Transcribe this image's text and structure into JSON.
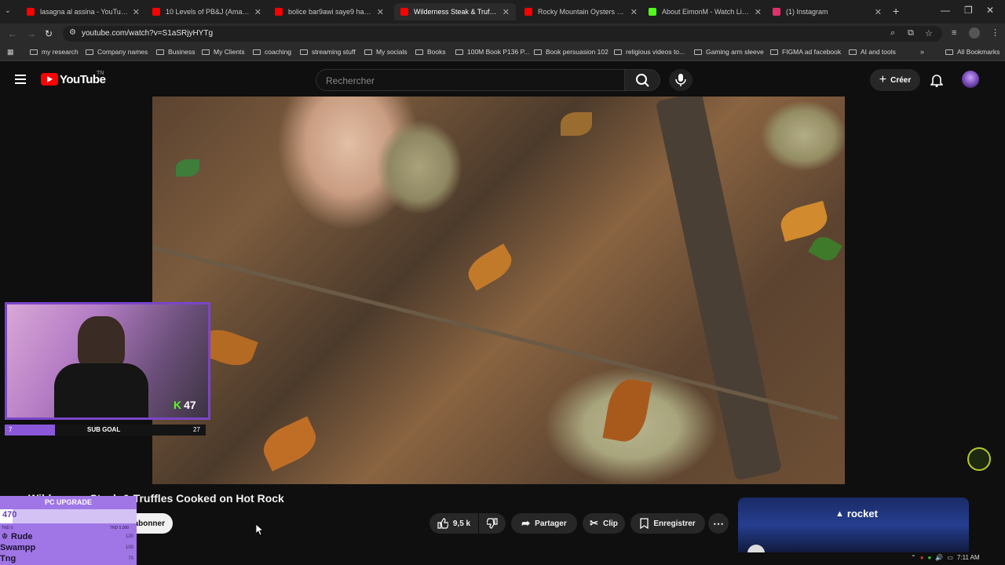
{
  "browser": {
    "tabs": [
      {
        "title": "lasagna al assina - YouTube",
        "color": "#ff0000"
      },
      {
        "title": "10 Levels of PB&J (Amateur to ...",
        "color": "#ff0000"
      },
      {
        "title": "bolice bar9awi saye9 hal9a - Yo...",
        "color": "#ff0000"
      },
      {
        "title": "Wilderness Steak & Truffle...",
        "color": "#ff0000"
      },
      {
        "title": "Rocky Mountain Oysters - YouT...",
        "color": "#ff0000"
      },
      {
        "title": "About EimonM - Watch Live on...",
        "color": "#53fc18"
      },
      {
        "title": "(1) Instagram",
        "color": "#e1306c"
      }
    ],
    "active_tab_index": 3,
    "url": "youtube.com/watch?v=S1aSRjyHYTg",
    "bookmarks": [
      "my research",
      "Company names",
      "Business",
      "My Clients",
      "coaching",
      "streaming stuff",
      "My socials",
      "Books",
      "100M Book P136 P...",
      "Book persuasion 102",
      "religious videos to...",
      "Gaming arm sleeve",
      "FIGMA ad facebook",
      "AI and tools"
    ],
    "all_bookmarks": "All Bookmarks"
  },
  "youtube": {
    "logo_text": "YouTube",
    "logo_sup": "TN",
    "search_placeholder": "Rechercher",
    "create_label": "Créer",
    "video_title": "Wilderness Steak & Truffles Cooked on Hot Rock",
    "subscribe_label": "abonner",
    "likes": "9,5 k",
    "share_label": "Partager",
    "clip_label": "Clip",
    "save_label": "Enregistrer",
    "ad_brand": "rocket"
  },
  "stream_overlay": {
    "cam_count": "47",
    "subgoal_label": "SUB GOAL",
    "subgoal_current": "7",
    "subgoal_target": "27",
    "upgrade_title": "PC UPGRADE",
    "upgrade_value": "470",
    "upgrade_fraction": 0.094,
    "upgrade_min": "TND 0",
    "upgrade_max": "TND 5,000",
    "donors": [
      {
        "name": "Rude",
        "amount": "120"
      },
      {
        "name": "Swampp",
        "amount": "100"
      },
      {
        "name": "Tng",
        "amount": "70"
      }
    ]
  },
  "system": {
    "time": "7:11 AM"
  }
}
